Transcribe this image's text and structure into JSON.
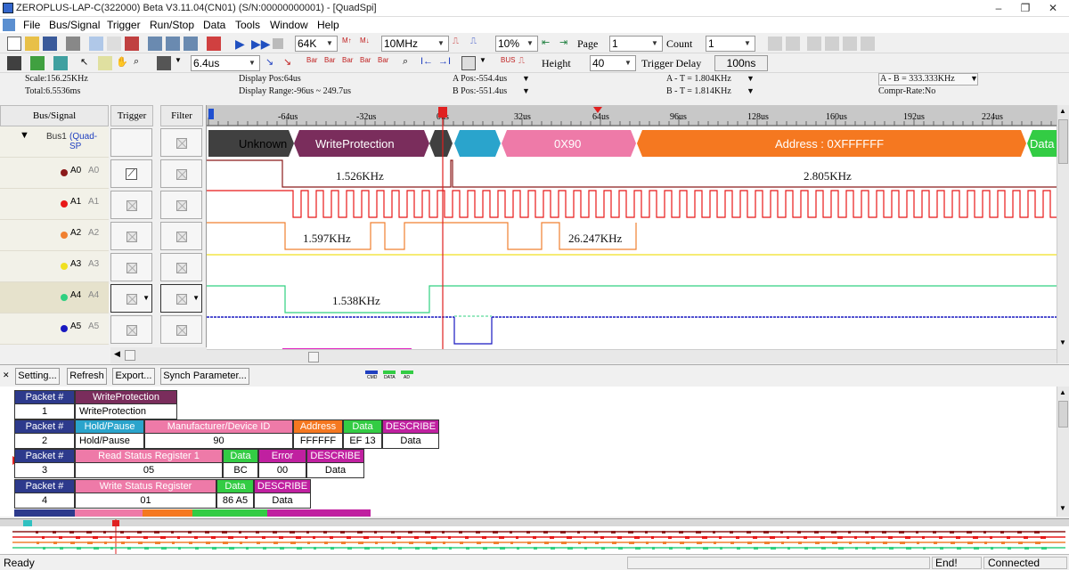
{
  "window": {
    "title": "ZEROPLUS-LAP-C(322000) Beta V3.11.04(CN01) (S/N:00000000001) - [QuadSpi]",
    "minimize": "–",
    "restore": "❐",
    "close": "✕"
  },
  "menu": [
    "File",
    "Bus/Signal",
    "Trigger",
    "Run/Stop",
    "Data",
    "Tools",
    "Window",
    "Help"
  ],
  "toolbar1": {
    "memory": "64K",
    "frequency": "10MHz",
    "trigger_pos": "10%",
    "page_label": "Page",
    "page_value": "1",
    "count_label": "Count",
    "count_value": "1"
  },
  "toolbar2": {
    "resolution": "6.4us",
    "height_label": "Height",
    "height_value": "40",
    "trigger_delay_label": "Trigger Delay",
    "trigger_delay_value": "100ns"
  },
  "info": {
    "scale": "Scale:156.25KHz",
    "total": "Total:6.5536ms",
    "display_pos": "Display Pos:64us",
    "display_range": "Display Range:-96us ~ 249.7us",
    "a_pos": "A Pos:-554.4us",
    "b_pos": "B Pos:-551.4us",
    "a_t": "A - T = 1.804KHz",
    "b_t": "B - T = 1.814KHz",
    "a_b": "A - B = 333.333KHz",
    "compr": "Compr-Rate:No"
  },
  "panel_headers": {
    "bus": "Bus/Signal",
    "trigger": "Trigger",
    "filter": "Filter"
  },
  "bus": {
    "name": "Bus1",
    "type": "(Quad-SP"
  },
  "channels": [
    {
      "name": "A0",
      "alias": "A0",
      "color": "#8b1a1a"
    },
    {
      "name": "A1",
      "alias": "A1",
      "color": "#e81818"
    },
    {
      "name": "A2",
      "alias": "A2",
      "color": "#f08030"
    },
    {
      "name": "A3",
      "alias": "A3",
      "color": "#f0e020"
    },
    {
      "name": "A4",
      "alias": "A4",
      "color": "#30d080"
    },
    {
      "name": "A5",
      "alias": "A5",
      "color": "#1818c0"
    }
  ],
  "ruler_ticks": [
    "-64us",
    "-32us",
    "0us",
    "32us",
    "64us",
    "96us",
    "128us",
    "160us",
    "192us",
    "224us"
  ],
  "decode": {
    "unknown": "Unknown",
    "wp": "WriteProtection",
    "cmd": "0X90",
    "addr": "Address : 0XFFFFFF",
    "data": "Data"
  },
  "freq": {
    "a0_1": "1.526KHz",
    "a0_2": "2.805KHz",
    "a2_1": "1.597KHz",
    "a2_2": "26.247KHz",
    "a4_1": "1.538KHz"
  },
  "buttons": {
    "setting": "Setting...",
    "refresh": "Refresh",
    "export": "Export...",
    "synch": "Synch Parameter..."
  },
  "legend": [
    "CMD",
    "DATA",
    "AD"
  ],
  "packets": [
    {
      "h": [
        "Packet #",
        "WriteProtection"
      ],
      "v": [
        "1",
        "WriteProtection"
      ]
    },
    {
      "h": [
        "Packet #",
        "Hold/Pause",
        "Manufacturer/Device ID",
        "Address",
        "Data",
        "DESCRIBE"
      ],
      "v": [
        "2",
        "Hold/Pause",
        "90",
        "FFFFFF",
        "EF  13",
        "Data"
      ]
    },
    {
      "h": [
        "Packet #",
        "Read Status Register 1",
        "Data",
        "Error",
        "DESCRIBE"
      ],
      "v": [
        "3",
        "05",
        "BC",
        "00",
        "Data"
      ]
    },
    {
      "h": [
        "Packet #",
        "Write Status Register",
        "Data",
        "DESCRIBE"
      ],
      "v": [
        "4",
        "01",
        "86  A5",
        "Data"
      ]
    }
  ],
  "status": {
    "ready": "Ready",
    "end": "End!",
    "connected": "Connected"
  }
}
